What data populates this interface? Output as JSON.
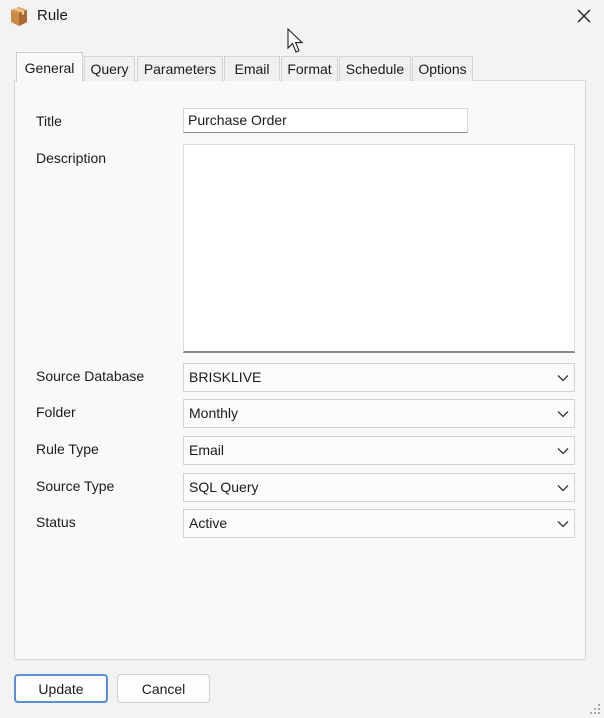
{
  "window": {
    "title": "Rule",
    "icon": "package-icon",
    "close_icon": "close-icon"
  },
  "tabs": [
    {
      "label": "General",
      "active": true
    },
    {
      "label": "Query",
      "active": false
    },
    {
      "label": "Parameters",
      "active": false
    },
    {
      "label": "Email",
      "active": false
    },
    {
      "label": "Format",
      "active": false
    },
    {
      "label": "Schedule",
      "active": false
    },
    {
      "label": "Options",
      "active": false
    }
  ],
  "form": {
    "title_label": "Title",
    "title_value": "Purchase Order",
    "description_label": "Description",
    "description_value": "",
    "source_database_label": "Source Database",
    "source_database_value": "BRISKLIVE",
    "folder_label": "Folder",
    "folder_value": "Monthly",
    "rule_type_label": "Rule Type",
    "rule_type_value": "Email",
    "source_type_label": "Source Type",
    "source_type_value": "SQL Query",
    "status_label": "Status",
    "status_value": "Active"
  },
  "buttons": {
    "update": "Update",
    "cancel": "Cancel"
  },
  "colors": {
    "accent": "#5b8fce",
    "panel": "#f9f9f9",
    "window": "#f3f3f3"
  }
}
